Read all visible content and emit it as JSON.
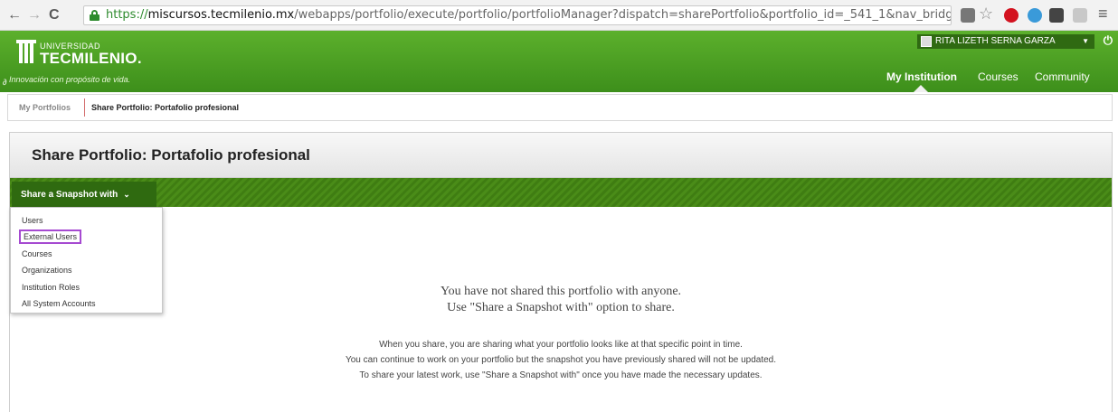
{
  "browser": {
    "url_scheme": "https://",
    "url_host": "miscursos.tecmilenio.mx",
    "url_path": "/webapps/portfolio/execute/portfolio/portfolioManager?dispatch=sharePortfolio&portfolio_id=_541_1&nav_bridge=cs_portfolio_basic_share",
    "back_icon": "←",
    "forward_icon": "→",
    "reload_icon": "C",
    "star_icon": "☆",
    "menu_icon": "≡",
    "extensions": [
      "translate-icon",
      "adblock-icon",
      "sync-icon",
      "pocket-icon",
      "shield-icon"
    ]
  },
  "header": {
    "logo_top": "UNIVERSIDAD",
    "logo_main": "TECMILENIO.",
    "tagline": "Innovación con propósito de vida.",
    "user_name": "RITA LIZETH SERNA GARZA",
    "user_caret": "▼",
    "power_icon": "⏻",
    "link_icon": "∂",
    "tabs": [
      {
        "label": "My Institution",
        "active": true
      },
      {
        "label": "Courses",
        "active": false
      },
      {
        "label": "Community",
        "active": false
      }
    ],
    "accent": "#4a9e21"
  },
  "breadcrumb": {
    "root": "My Portfolios",
    "current": "Share Portfolio: Portafolio profesional"
  },
  "page": {
    "title": "Share Portfolio: Portafolio profesional",
    "share_button": "Share a Snapshot with",
    "share_caret": "⌵",
    "menu": [
      "Users",
      "External Users",
      "Courses",
      "Organizations",
      "Institution Roles",
      "All System Accounts"
    ],
    "focused_menu_item": "External Users",
    "empty_line1": "You have not shared this portfolio with anyone.",
    "empty_line2": "Use \"Share a Snapshot with\" option to share.",
    "info_line1": "When you share, you are sharing what your portfolio looks like at that specific point in time.",
    "info_line2": "You can continue to work on your portfolio but the snapshot you have previously shared will not be updated.",
    "info_line3": "To share your latest work, use \"Share a Snapshot with\" once you have made the necessary updates."
  }
}
